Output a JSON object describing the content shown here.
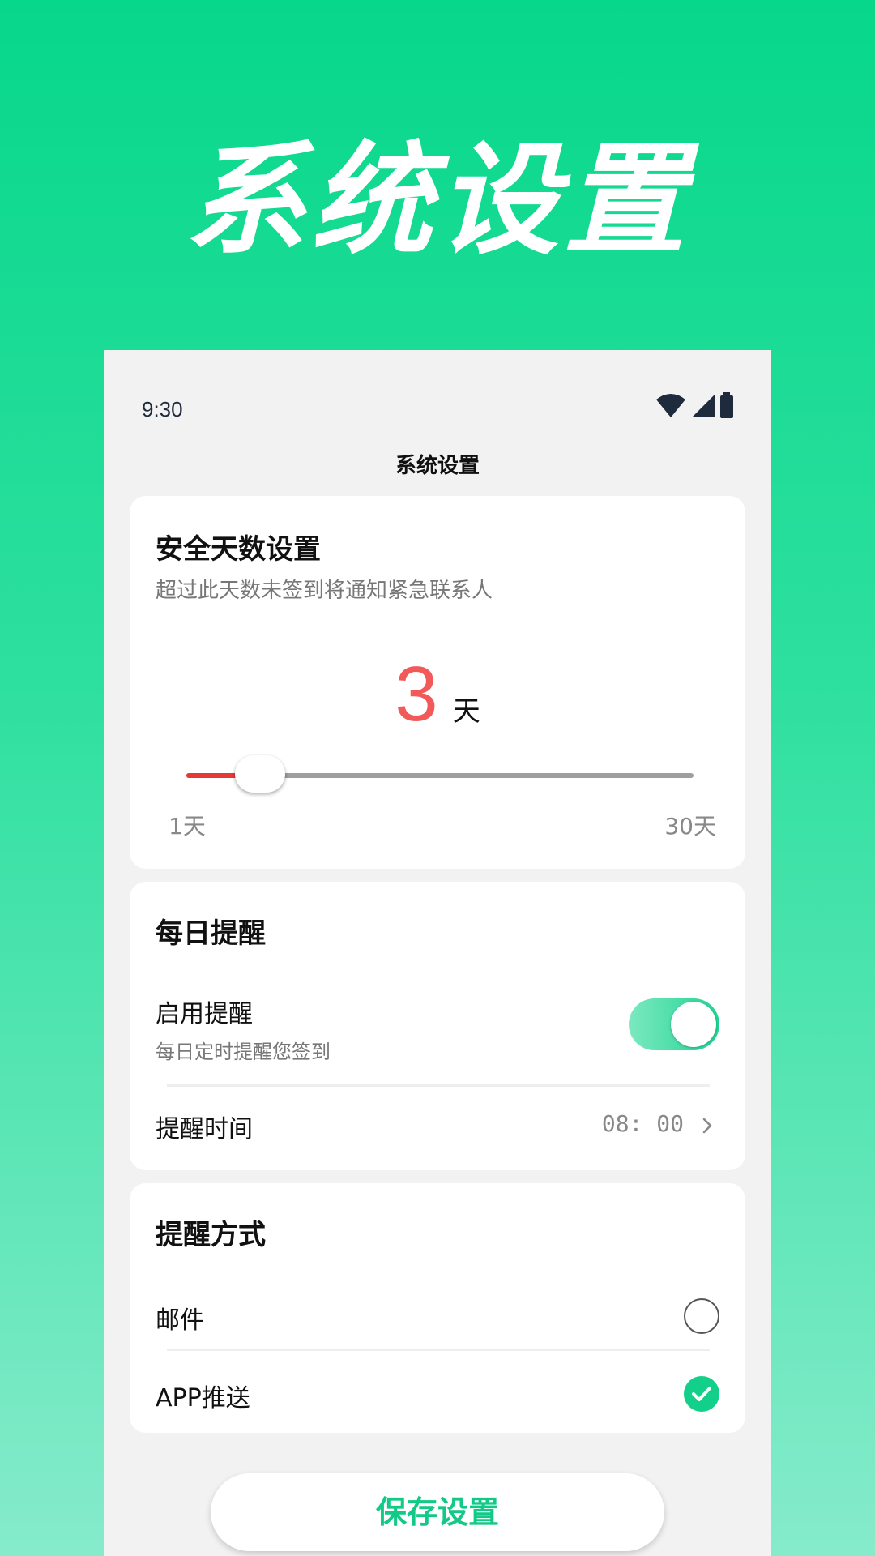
{
  "hero": {
    "title": "系统设置"
  },
  "status_bar": {
    "time": "9:30",
    "icons": [
      "wifi-icon",
      "signal-icon",
      "battery-icon"
    ]
  },
  "nav": {
    "title": "系统设置"
  },
  "safety_days": {
    "title": "安全天数设置",
    "subtitle": "超过此天数未签到将通知紧急联系人",
    "value": "3",
    "unit": "天",
    "slider": {
      "value": 3,
      "min": 1,
      "max": 30
    },
    "min_label": "1天",
    "max_label": "30天"
  },
  "daily_reminder": {
    "title": "每日提醒",
    "enable_label": "启用提醒",
    "enable_sub": "每日定时提醒您签到",
    "enabled": true,
    "time_label": "提醒时间",
    "time_value": "08: 00"
  },
  "reminder_method": {
    "title": "提醒方式",
    "options": [
      {
        "label": "邮件",
        "selected": false
      },
      {
        "label": "APP推送",
        "selected": true
      }
    ]
  },
  "save_button": {
    "label": "保存设置"
  },
  "colors": {
    "accent": "#12c987",
    "days_number": "#f25a5a",
    "slider_fill": "#e53935",
    "background_top": "#07d78b",
    "background_bottom": "#86ebcb"
  }
}
